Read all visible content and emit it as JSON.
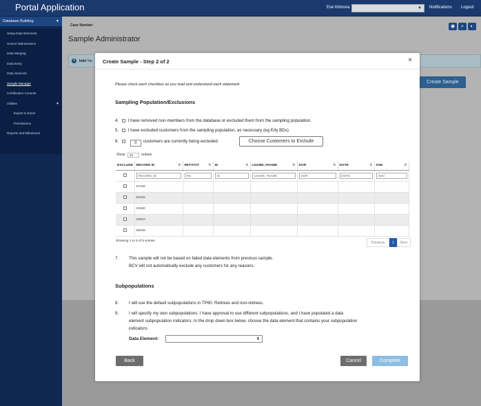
{
  "app": {
    "title": "Portal Application"
  },
  "topbar": {
    "user_name": "Eve Klimova",
    "nav": [
      "Notifications",
      "Logout"
    ]
  },
  "sidebar": {
    "header": "Database Building",
    "items": [
      {
        "label": "Setup Data Elements"
      },
      {
        "label": "Source Maintenance"
      },
      {
        "label": "Data Merging"
      },
      {
        "label": "Data Entry"
      },
      {
        "label": "Data Services"
      },
      {
        "label": "Sample Manager"
      },
      {
        "label": "Certification Console"
      },
      {
        "label": "Utilities"
      },
      {
        "label": "Export to Excel"
      },
      {
        "label": "Permissions"
      },
      {
        "label": "Reports and Milestones"
      }
    ]
  },
  "page": {
    "case_label": "Case Number:",
    "title": "Sample Administrator",
    "info_label": "Info!",
    "info_text": "No",
    "create_sample": "Create Sample"
  },
  "modal": {
    "title": "Create Sample - Step 2 of 2",
    "close": "×",
    "intro": "Please check each checkbox as you read and understand each statement.",
    "section1": "Sampling Population/Exclusions",
    "stmt4_num": "4.",
    "stmt4": "I have removed non-members from the database or excluded them from the sampling population.",
    "stmt5_num": "5.",
    "stmt5": "I have excluded customers from the sampling population, as necessary (eg Erly BDs)",
    "stmt6_num": "6.",
    "stmt6_count": "0",
    "stmt6": "customers are currently being excluded.",
    "choose_button": "Choose Customers to Exclude",
    "show_label": "Show",
    "show_value": "10",
    "entries_label": "entries",
    "columns": [
      "EXCLUDE",
      "RECORD ID",
      "RETSTAT",
      "ID",
      "LNAME, FNAME",
      "DOR",
      "DOTE",
      "SSN"
    ],
    "filters": [
      "RECORD_ID",
      "RS",
      "ID",
      "LNAME, FNAME",
      "DOR",
      "DOTE",
      "SSN"
    ],
    "rows": [
      {
        "record_id": "67428"
      },
      {
        "record_id": "89305"
      },
      {
        "record_id": "29480"
      },
      {
        "record_id": "28910"
      },
      {
        "record_id": "89049"
      }
    ],
    "showing": "Showing 1 to 5 of 5 entries",
    "pager": {
      "prev": "Previous",
      "page": "1",
      "next": "Next"
    },
    "stmt7_num": "7.",
    "stmt7_line1": "This sample will not be based on failed data elements from previous sample.",
    "stmt7_line2": "BCV will not automatically exclude any customers for any reasons.",
    "section2": "Subpopulations",
    "stmt8_num": "8.",
    "stmt8": "I will use the default subpopulations in TP60: Retirees and non-retirees.",
    "stmt9_num": "9.",
    "stmt9_line1": "I will specify my own subpopulations. I have approval to use different subpopulations, and I have populated a data",
    "stmt9_line2": "element subpopulation indicators. In the drop down box below, choose the data element that contains your subpopulation",
    "stmt9_line3": "indicators:",
    "data_element_label": "Data Element:",
    "buttons": {
      "back": "Back",
      "cancel": "Cancel",
      "complete": "Complete"
    }
  }
}
